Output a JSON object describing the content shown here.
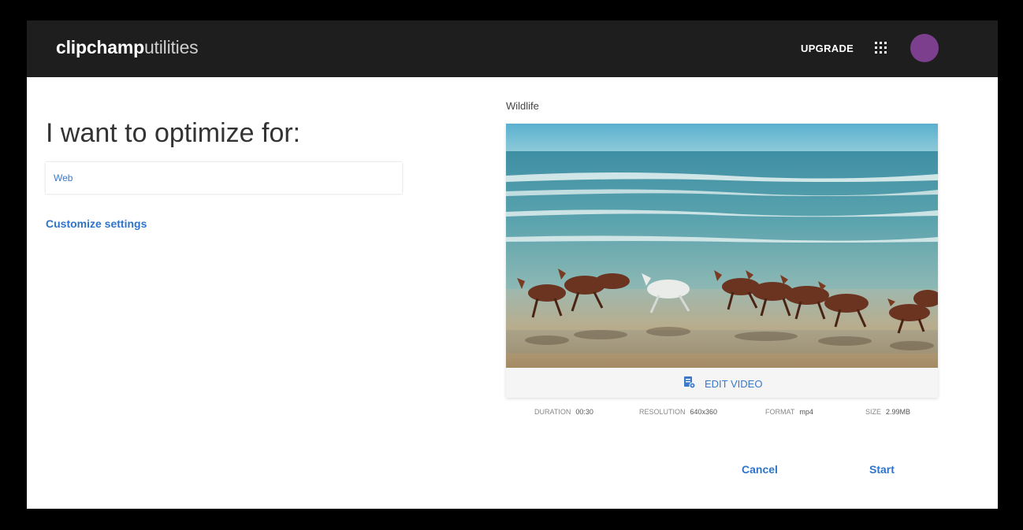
{
  "header": {
    "logo_bold": "clipchamp",
    "logo_light": "utilities",
    "upgrade_label": "UPGRADE",
    "apps_icon": "grid-apps-icon",
    "avatar_color": "#7b3f8e"
  },
  "left": {
    "heading": "I want to optimize for:",
    "select_value": "Web",
    "customize_label": "Customize settings"
  },
  "video": {
    "title": "Wildlife",
    "edit_label": "EDIT VIDEO",
    "edit_icon": "edit-video-icon",
    "meta": [
      {
        "label": "DURATION",
        "value": "00:30"
      },
      {
        "label": "RESOLUTION",
        "value": "640x360"
      },
      {
        "label": "FORMAT",
        "value": "mp4"
      },
      {
        "label": "SIZE",
        "value": "2.99MB"
      }
    ]
  },
  "actions": {
    "cancel_label": "Cancel",
    "start_label": "Start"
  },
  "colors": {
    "accent": "#2f74c8",
    "topbar": "#1e1e1e"
  }
}
